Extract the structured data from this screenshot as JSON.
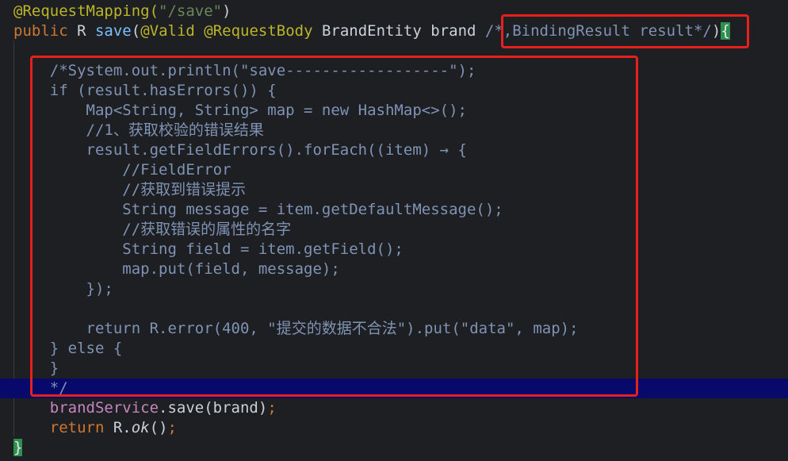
{
  "code_lines": [
    {
      "tokens": [
        {
          "t": "@RequestMapping(",
          "c": "annotation"
        },
        {
          "t": "\"/save\"",
          "c": "string"
        },
        {
          "t": ")",
          "c": "plain"
        }
      ]
    },
    {
      "tokens": [
        {
          "t": "public ",
          "c": "keyword"
        },
        {
          "t": "R ",
          "c": "plain"
        },
        {
          "t": "save",
          "c": "method"
        },
        {
          "t": "(",
          "c": "plain"
        },
        {
          "t": "@Valid ",
          "c": "annotation"
        },
        {
          "t": "@RequestBody ",
          "c": "annotation"
        },
        {
          "t": "BrandEntity brand ",
          "c": "plain"
        },
        {
          "t": "/*,BindingResult result*/",
          "c": "comment"
        },
        {
          "t": ")",
          "c": "plain"
        },
        {
          "t": "{",
          "c": "brace"
        }
      ]
    },
    {
      "tokens": [
        {
          "t": "",
          "c": "plain"
        }
      ]
    },
    {
      "tokens": [
        {
          "t": "    /*System.out.println(\"save------------------\");",
          "c": "comment"
        }
      ]
    },
    {
      "tokens": [
        {
          "t": "    if (result.hasErrors()) {",
          "c": "comment"
        }
      ]
    },
    {
      "tokens": [
        {
          "t": "        Map<String, String> map = new HashMap<>();",
          "c": "comment"
        }
      ]
    },
    {
      "tokens": [
        {
          "t": "        //1、获取校验的错误结果",
          "c": "comment"
        }
      ]
    },
    {
      "tokens": [
        {
          "t": "        result.getFieldErrors().forEach((item) → {",
          "c": "comment"
        }
      ]
    },
    {
      "tokens": [
        {
          "t": "            //FieldError",
          "c": "comment"
        }
      ]
    },
    {
      "tokens": [
        {
          "t": "            //获取到错误提示",
          "c": "comment"
        }
      ]
    },
    {
      "tokens": [
        {
          "t": "            String message = item.getDefaultMessage();",
          "c": "comment"
        }
      ]
    },
    {
      "tokens": [
        {
          "t": "            //获取错误的属性的名字",
          "c": "comment"
        }
      ]
    },
    {
      "tokens": [
        {
          "t": "            String field = item.getField();",
          "c": "comment"
        }
      ]
    },
    {
      "tokens": [
        {
          "t": "            map.put(field, message);",
          "c": "comment"
        }
      ]
    },
    {
      "tokens": [
        {
          "t": "        });",
          "c": "comment"
        }
      ]
    },
    {
      "tokens": [
        {
          "t": "",
          "c": "plain"
        }
      ]
    },
    {
      "tokens": [
        {
          "t": "        return R.error(400, \"提交的数据不合法\").put(\"data\", map);",
          "c": "comment"
        }
      ]
    },
    {
      "tokens": [
        {
          "t": "    } else {",
          "c": "comment"
        }
      ]
    },
    {
      "tokens": [
        {
          "t": "    }",
          "c": "comment"
        }
      ]
    },
    {
      "tokens": [
        {
          "t": "    */",
          "c": "comment"
        }
      ]
    },
    {
      "tokens": [
        {
          "t": "    ",
          "c": "plain"
        },
        {
          "t": "brandService",
          "c": "field"
        },
        {
          "t": ".save(brand)",
          "c": "plain"
        },
        {
          "t": ";",
          "c": "semi"
        }
      ]
    },
    {
      "tokens": [
        {
          "t": "    ",
          "c": "plain"
        },
        {
          "t": "return ",
          "c": "keyword"
        },
        {
          "t": "R.",
          "c": "plain"
        },
        {
          "t": "ok",
          "c": "italic"
        },
        {
          "t": "()",
          "c": "plain"
        },
        {
          "t": ";",
          "c": "semi"
        }
      ]
    },
    {
      "tokens": [
        {
          "t": "}",
          "c": "brace"
        }
      ]
    }
  ],
  "highlighted_line": 19,
  "colors": {
    "background": "#1e1f22",
    "highlight_line": "#07096b",
    "annotation_box": "#e8201c",
    "comment": "#7f93b5"
  }
}
